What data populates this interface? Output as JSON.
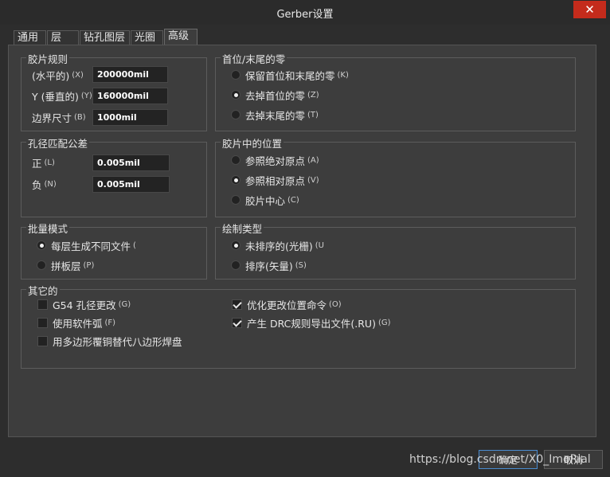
{
  "window": {
    "title": "Gerber设置",
    "close_label": "✕"
  },
  "tabs": [
    {
      "label": "通用"
    },
    {
      "label": "层"
    },
    {
      "label": "钻孔图层"
    },
    {
      "label": "光圈"
    },
    {
      "label": "高级"
    }
  ],
  "film_rules": {
    "title": "胶片规则",
    "x_label": "(水平的)",
    "x_key": "(X)",
    "x_value": "200000mil",
    "y_label": "Y (垂直的)",
    "y_key": "(Y)",
    "y_value": "160000mil",
    "border_label": "边界尺寸",
    "border_key": "(B)",
    "border_value": "1000mil"
  },
  "zeros": {
    "title": "首位/末尾的零",
    "options": [
      {
        "label": "保留首位和末尾的零",
        "key": "(K)",
        "selected": false
      },
      {
        "label": "去掉首位的零",
        "key": "(Z)",
        "selected": true
      },
      {
        "label": "去掉末尾的零",
        "key": "(T)",
        "selected": false
      }
    ]
  },
  "tolerance": {
    "title": "孔径匹配公差",
    "plus_label": "正",
    "plus_key": "(L)",
    "plus_value": "0.005mil",
    "minus_label": "负",
    "minus_key": "(N)",
    "minus_value": "0.005mil"
  },
  "film_position": {
    "title": "胶片中的位置",
    "options": [
      {
        "label": "参照绝对原点",
        "key": "(A)",
        "selected": false
      },
      {
        "label": "参照相对原点",
        "key": "(V)",
        "selected": true
      },
      {
        "label": "胶片中心",
        "key": "(C)",
        "selected": false
      }
    ]
  },
  "batch_mode": {
    "title": "批量模式",
    "options": [
      {
        "label": "每层生成不同文件",
        "key": "(",
        "selected": true
      },
      {
        "label": "拼板层",
        "key": "(P)",
        "selected": false
      }
    ]
  },
  "plot_type": {
    "title": "绘制类型",
    "options": [
      {
        "label": "未排序的(光栅)",
        "key": "(U",
        "selected": true
      },
      {
        "label": "排序(矢量)",
        "key": "(S)",
        "selected": false
      }
    ]
  },
  "other": {
    "title": "其它的",
    "items": [
      {
        "label": "G54 孔径更改",
        "key": "(G)",
        "checked": false
      },
      {
        "label": "使用软件弧",
        "key": "(F)",
        "checked": false
      },
      {
        "label": "用多边形覆铜替代八边形焊盘",
        "key": "",
        "checked": false
      },
      {
        "label": "优化更改位置命令",
        "key": "(O)",
        "checked": true
      },
      {
        "label": "产生 DRC规则导出文件(.RU)",
        "key": "(G)",
        "checked": true
      }
    ]
  },
  "buttons": {
    "ok": "确定",
    "cancel": "取消"
  },
  "watermark": "https://blog.csdn.net/X0_ImoRial"
}
